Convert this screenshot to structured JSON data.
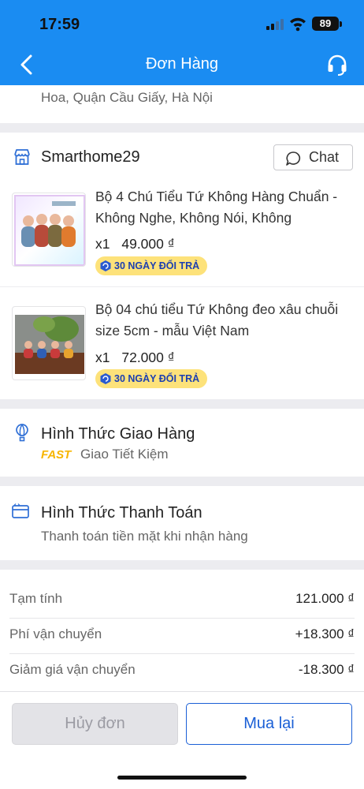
{
  "status_bar": {
    "time": "17:59",
    "battery": "89"
  },
  "header": {
    "title": "Đơn Hàng"
  },
  "address": {
    "text": "Hoa, Quận Cầu Giấy, Hà Nội"
  },
  "shop": {
    "name": "Smarthome29",
    "chat_label": "Chat"
  },
  "products": [
    {
      "name": "Bộ 4 Chú Tiểu Tứ Không Hàng Chuẩn - Không Nghe, Không Nói, Không",
      "qty": "x1",
      "price": "49.000 ₫",
      "badge": "30 NGÀY ĐỔI TRẢ"
    },
    {
      "name": "Bộ 04 chú tiểu Tứ Không đeo xâu chuỗi size 5cm - mẫu Việt Nam",
      "qty": "x1",
      "price": "72.000 ₫",
      "badge": "30 NGÀY ĐỔI TRẢ"
    }
  ],
  "delivery": {
    "title": "Hình Thức Giao Hàng",
    "tag": "FAST",
    "method": "Giao Tiết Kiệm"
  },
  "payment": {
    "title": "Hình Thức Thanh Toán",
    "method": "Thanh toán tiền mặt khi nhận hàng"
  },
  "summary": [
    {
      "label": "Tạm tính",
      "value": "121.000 ₫"
    },
    {
      "label": "Phí vận chuyển",
      "value": "+18.300 ₫"
    },
    {
      "label": "Giảm giá vận chuyển",
      "value": "-18.300 ₫"
    }
  ],
  "actions": {
    "cancel_label": "Hủy đơn",
    "rebuy_label": "Mua lại"
  },
  "colors": {
    "brand": "#1a8cf2",
    "badge_bg": "#fde27a",
    "fast": "#f7b500",
    "action_blue": "#1a5fd6"
  }
}
